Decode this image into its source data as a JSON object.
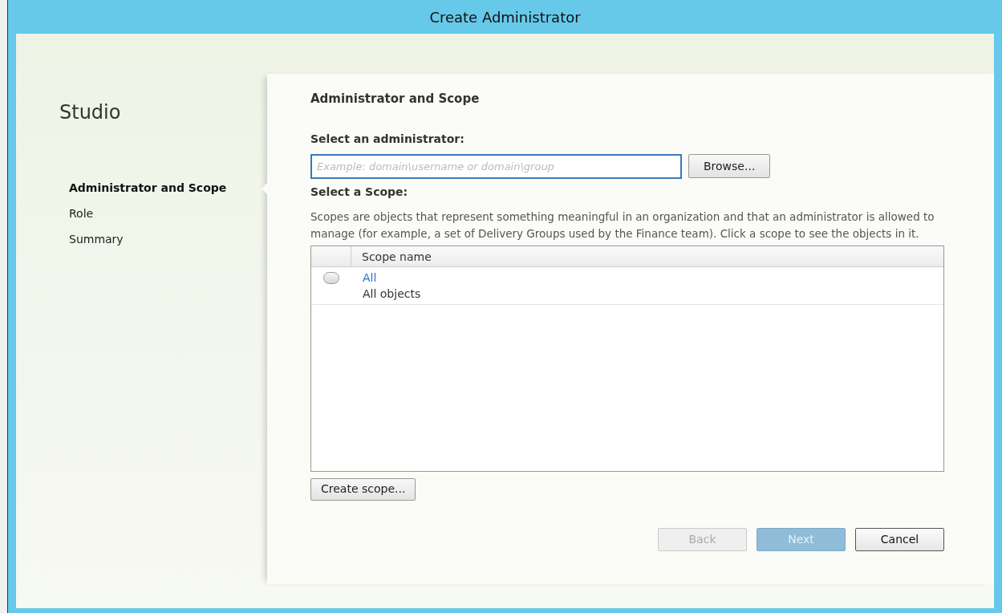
{
  "window": {
    "title": "Create Administrator"
  },
  "sidebar": {
    "title": "Studio",
    "steps": [
      {
        "label": "Administrator and Scope",
        "selected": true
      },
      {
        "label": "Role",
        "selected": false
      },
      {
        "label": "Summary",
        "selected": false
      }
    ]
  },
  "page": {
    "heading": "Administrator and Scope",
    "admin_label": "Select an administrator:",
    "admin_field": {
      "placeholder": "Example: domain\\username or domain\\group"
    },
    "browse_button": "Browse...",
    "scope_label": "Select a Scope:",
    "scope_description": "Scopes are objects that represent something meaningful in an organization and that an administrator is allowed to manage (for example, a set of Delivery Groups used by the Finance team). Click a scope to see the objects in it.",
    "table": {
      "columns": [
        "Scope name"
      ],
      "rows": [
        {
          "name": "All",
          "description": "All objects",
          "selected": false
        }
      ]
    },
    "create_button": "Create scope..."
  },
  "buttons": [
    {
      "label": "Back",
      "disabled": true,
      "kind": "plain"
    },
    {
      "label": "Next",
      "disabled": true,
      "kind": "primary"
    },
    {
      "label": "Cancel",
      "disabled": false,
      "kind": "plain"
    }
  ]
}
